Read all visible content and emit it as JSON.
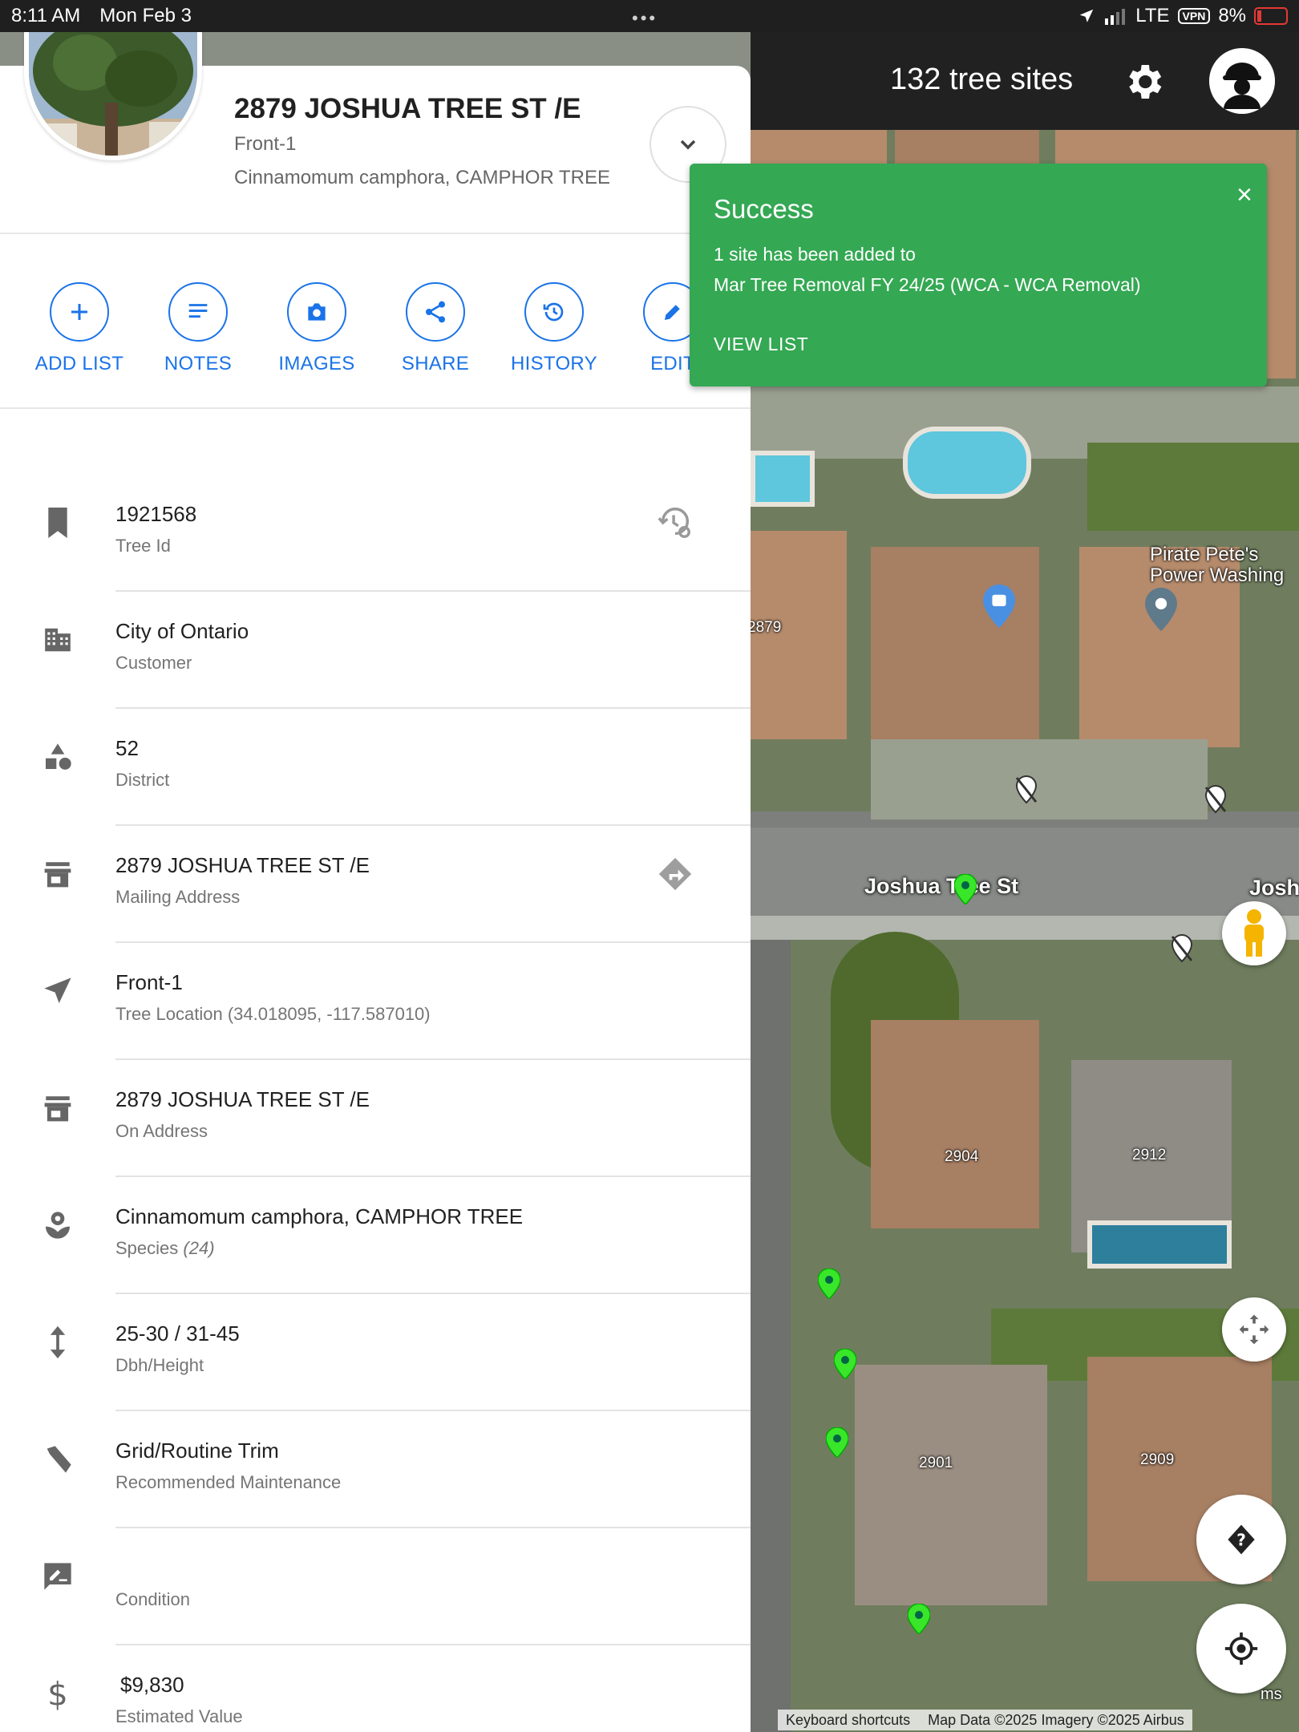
{
  "status": {
    "time": "8:11 AM",
    "date": "Mon Feb 3",
    "network": "LTE",
    "vpn": "VPN",
    "battery": "8%"
  },
  "header": {
    "site_count": "132 tree sites"
  },
  "toast": {
    "title": "Success",
    "line1": "1 site has been added to",
    "line2": "Mar Tree Removal FY 24/25 (WCA - WCA Removal)",
    "action": "VIEW LIST",
    "close": "×"
  },
  "site": {
    "address": "2879 JOSHUA TREE ST /E",
    "location": "Front-1",
    "species": "Cinnamomum camphora, CAMPHOR TREE"
  },
  "actions": [
    {
      "label": "ADD LIST",
      "icon": "plus-icon"
    },
    {
      "label": "NOTES",
      "icon": "notes-icon"
    },
    {
      "label": "IMAGES",
      "icon": "camera-icon"
    },
    {
      "label": "SHARE",
      "icon": "share-icon"
    },
    {
      "label": "HISTORY",
      "icon": "history-icon"
    },
    {
      "label": "EDIT",
      "icon": "pencil-icon"
    }
  ],
  "details": [
    {
      "value": "1921568",
      "label": "Tree Id",
      "icon": "bookmark-icon"
    },
    {
      "value": "City of Ontario",
      "label": "Customer",
      "icon": "building-icon"
    },
    {
      "value": "52",
      "label": "District",
      "icon": "shapes-icon"
    },
    {
      "value": "2879 JOSHUA TREE ST /E",
      "label": "Mailing Address",
      "icon": "store-icon"
    },
    {
      "value": "Front-1",
      "label": "Tree Location (34.018095, -117.587010)",
      "icon": "navigation-icon"
    },
    {
      "value": "2879 JOSHUA TREE ST /E",
      "label": "On Address",
      "icon": "store-icon"
    },
    {
      "value": "Cinnamomum camphora, CAMPHOR TREE",
      "label": "Species",
      "label_extra": "(24)",
      "icon": "flower-icon"
    },
    {
      "value": "25-30 / 31-45",
      "label": "Dbh/Height",
      "icon": "vertical-arrows-icon"
    },
    {
      "value": "Grid/Routine Trim",
      "label": "Recommended Maintenance",
      "icon": "saw-icon"
    },
    {
      "value": "",
      "label": "Condition",
      "icon": "rate-review-icon"
    },
    {
      "value": "$9,830",
      "label": "Estimated Value",
      "icon": "dollar-icon"
    }
  ],
  "map": {
    "street": "Joshua Tree St",
    "street_partial": "Josh",
    "business": "Pirate Pete's",
    "business_line2": "Power Washing",
    "lot_2879": "2879",
    "lot_2904": "2904",
    "lot_2912": "2912",
    "lot_2901": "2901",
    "lot_2909": "2909",
    "attrib_shortcuts": "Keyboard shortcuts",
    "attrib_data": "Map Data ©2025 Imagery ©2025 Airbus",
    "attrib_terms": "ms"
  },
  "colors": {
    "accent": "#1a73e8",
    "success": "#34a853",
    "pin_green": "#39e629",
    "header_bg": "#212121"
  }
}
